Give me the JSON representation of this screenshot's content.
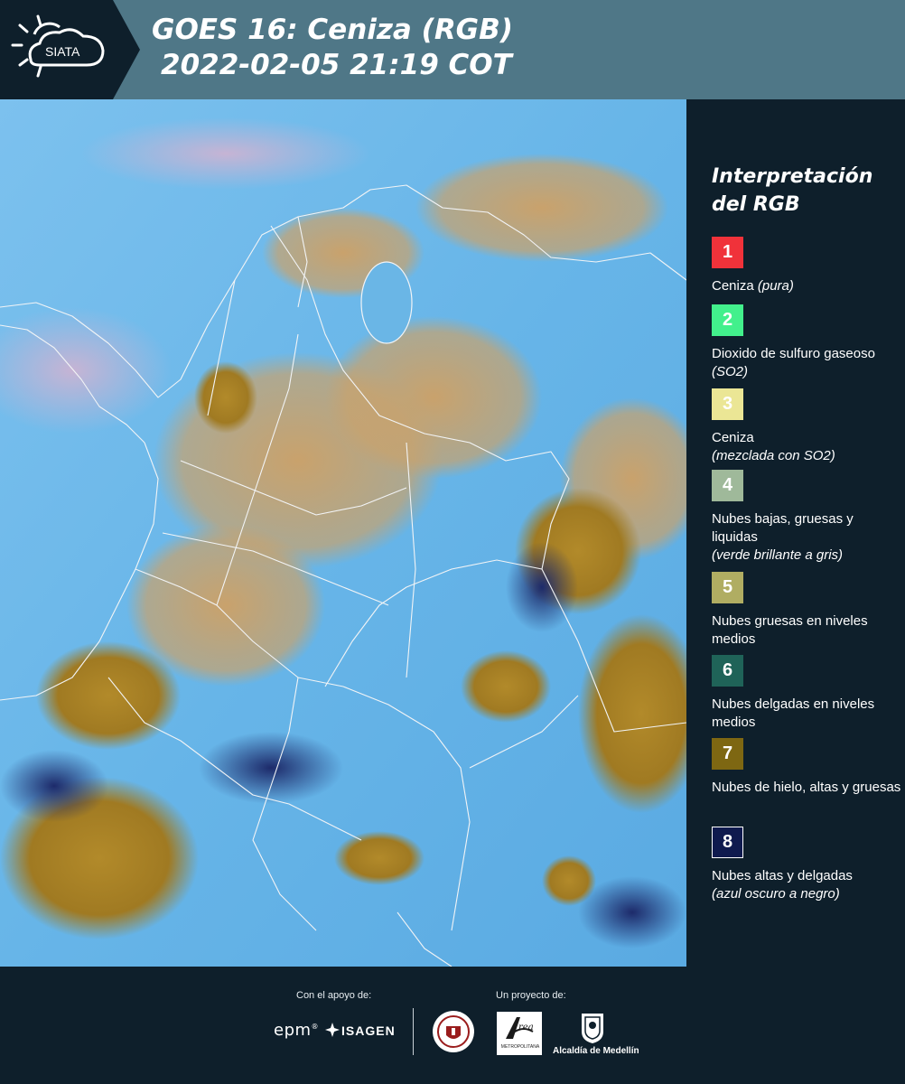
{
  "header": {
    "logo_text": "SIATA",
    "title_line1": "GOES 16: Ceniza (RGB)",
    "title_line2": "2022-02-05 21:19 COT"
  },
  "legend": {
    "title": "Interpretación del RGB",
    "items": [
      {
        "number": "1",
        "color": "#f0323a",
        "label": "Ceniza",
        "sub": "(pura)"
      },
      {
        "number": "2",
        "color": "#42f08c",
        "label": "Dioxido de sulfuro gaseoso",
        "sub": "(SO2)"
      },
      {
        "number": "3",
        "color": "#ebe695",
        "label": "Ceniza",
        "sub": "(mezclada con SO2)"
      },
      {
        "number": "4",
        "color": "#9fb99a",
        "label": "Nubes bajas, gruesas y liquidas",
        "sub": "(verde brillante a gris)"
      },
      {
        "number": "5",
        "color": "#b0ad62",
        "label": "Nubes gruesas en niveles medios",
        "sub": ""
      },
      {
        "number": "6",
        "color": "#1f6358",
        "label": "Nubes delgadas en niveles medios",
        "sub": ""
      },
      {
        "number": "7",
        "color": "#7e6712",
        "label": "Nubes de hielo, altas y gruesas",
        "sub": ""
      },
      {
        "number": "8",
        "color": "#0f1a4e",
        "label": "Nubes altas y delgadas",
        "sub": "(azul oscuro a negro)"
      }
    ]
  },
  "footer": {
    "support_label": "Con el apoyo de:",
    "project_label": "Un proyecto de:",
    "epm": "epm",
    "isagen": "ISAGEN",
    "area_text": "METROPOLITANA",
    "alcaldia": "Alcaldía de Medellín"
  },
  "colors": {
    "header_bg": "#4f7787",
    "page_bg": "#0e1f2b",
    "map_sky": "#69b6e8",
    "cloud_tan": "#c8a06a",
    "cloud_gold": "#b08a28",
    "border_white": "#f2f4f6"
  }
}
